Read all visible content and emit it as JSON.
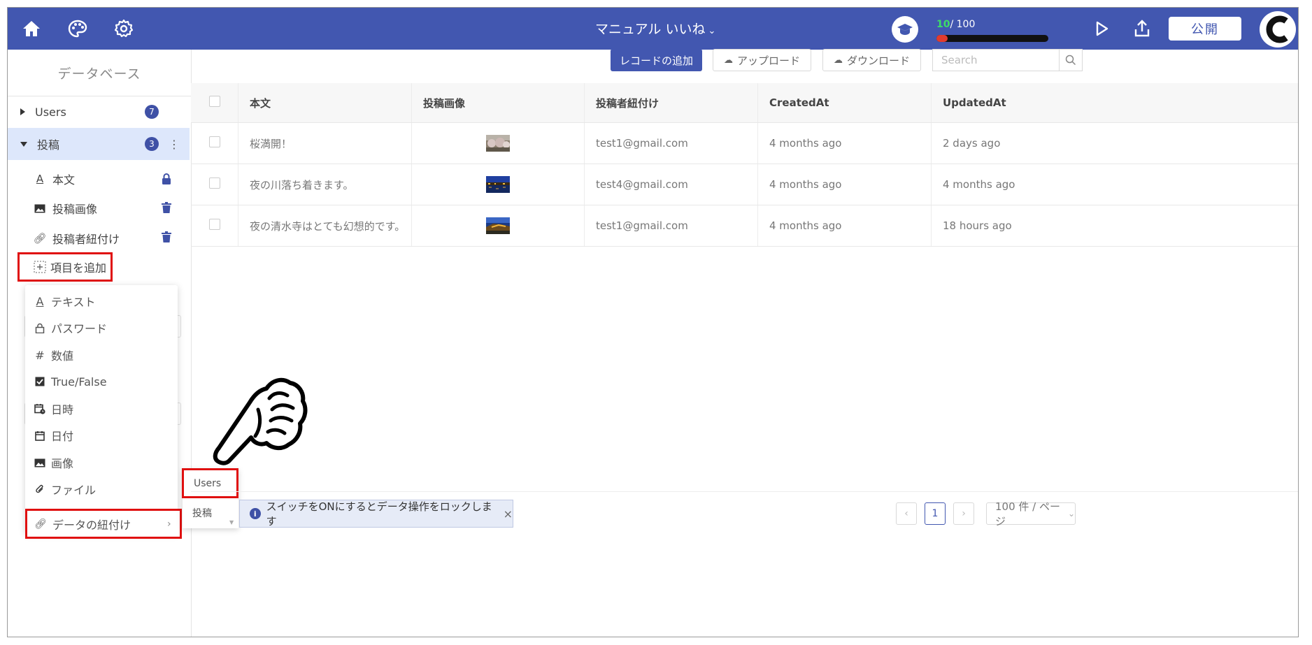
{
  "header": {
    "app_title": "マニュアル いいね",
    "progress_current": "10",
    "progress_total": "/ 100",
    "progress_fraction": 0.1,
    "publish_label": "公開",
    "accent_color": "#4257b0"
  },
  "sidebar": {
    "title": "データベース",
    "tables": [
      {
        "label": "Users",
        "count": "7"
      },
      {
        "label": "投稿",
        "count": "3"
      }
    ],
    "fields": [
      {
        "label": "本文",
        "icon": "text-icon",
        "action_icon": "lock-icon"
      },
      {
        "label": "投稿画像",
        "icon": "image-icon",
        "action_icon": "trash-icon"
      },
      {
        "label": "投稿者紐付け",
        "icon": "link-icon",
        "action_icon": "trash-icon"
      }
    ],
    "add_field_label": "項目を追加"
  },
  "field_type_menu": {
    "items": [
      {
        "label": "テキスト",
        "icon": "text-icon"
      },
      {
        "label": "パスワード",
        "icon": "lock-icon"
      },
      {
        "label": "数値",
        "icon": "hash-icon"
      },
      {
        "label": "True/False",
        "icon": "checkbox-icon"
      },
      {
        "label": "日時",
        "icon": "datetime-icon"
      },
      {
        "label": "日付",
        "icon": "calendar-icon"
      },
      {
        "label": "画像",
        "icon": "image-icon"
      },
      {
        "label": "ファイル",
        "icon": "paperclip-icon"
      }
    ],
    "link_item": {
      "label": "データの紐付け",
      "icon": "link-icon"
    },
    "submenu": [
      "Users",
      "投稿"
    ]
  },
  "toolbar": {
    "add_record_label": "レコードの追加",
    "upload_label": "アップロード",
    "download_label": "ダウンロード",
    "search_placeholder": "Search"
  },
  "table": {
    "columns": [
      "本文",
      "投稿画像",
      "投稿者紐付け",
      "CreatedAt",
      "UpdatedAt"
    ],
    "rows": [
      {
        "body": "桜満開！",
        "image": "cherry-blossom-thumbnail",
        "user": "test1@gmail.com",
        "created": "4 months ago",
        "updated": "2 days ago"
      },
      {
        "body": "夜の川落ち着きます。",
        "image": "night-river-thumbnail",
        "user": "test4@gmail.com",
        "created": "4 months ago",
        "updated": "4 months ago"
      },
      {
        "body": "夜の清水寺はとても幻想的です。",
        "image": "kiyomizu-night-thumbnail",
        "user": "test1@gmail.com",
        "created": "4 months ago",
        "updated": "18 hours ago"
      }
    ]
  },
  "footer": {
    "lock_notice": "スイッチをONにするとデータ操作をロックします",
    "close_symbol": "×",
    "current_page": "1",
    "per_page_label": "100 件 / ページ"
  }
}
